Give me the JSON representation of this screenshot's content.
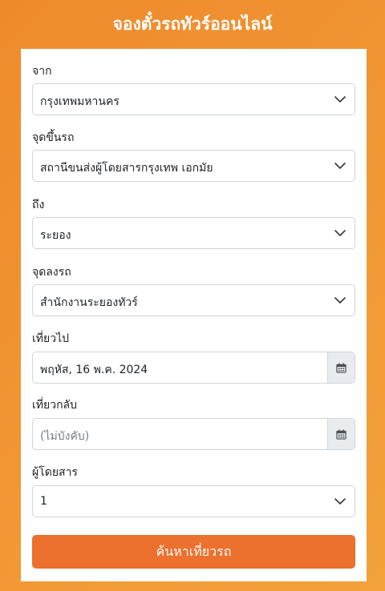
{
  "header": {
    "title": "จองตั๋วรถทัวร์ออนไลน์"
  },
  "form": {
    "from": {
      "label": "จาก",
      "value": "กรุงเทพมหานคร"
    },
    "pickup": {
      "label": "จุดขึ้นรถ",
      "value": "สถานีขนส่งผู้โดยสารกรุงเทพ เอกมัย"
    },
    "to": {
      "label": "ถึง",
      "value": "ระยอง"
    },
    "dropoff": {
      "label": "จุดลงรถ",
      "value": "สำนักงานระยองทัวร์"
    },
    "depart": {
      "label": "เที่ยวไป",
      "value": "พฤหัส, 16 พ.ค. 2024"
    },
    "return": {
      "label": "เที่ยวกลับ",
      "placeholder": "(ไม่บังคับ)"
    },
    "passengers": {
      "label": "ผู้โดยสาร",
      "value": "1"
    },
    "search_label": "ค้นหาเที่ยวรถ"
  },
  "icons": {
    "dropdown": "chevron-down-icon",
    "calendar": "calendar-icon"
  },
  "colors": {
    "accent": "#ec702e",
    "background": "#f09434"
  }
}
